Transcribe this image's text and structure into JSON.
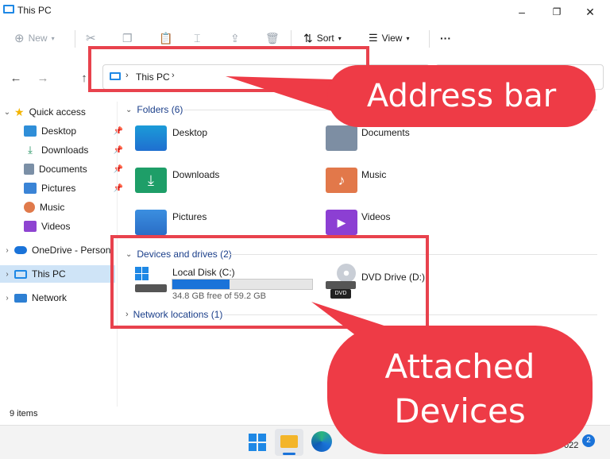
{
  "window": {
    "title": "This PC"
  },
  "toolbar": {
    "new_label": "New",
    "sort_label": "Sort",
    "view_label": "View",
    "more_label": "···"
  },
  "address": {
    "crumb": "This PC"
  },
  "sidebar": {
    "items": [
      {
        "label": "Quick access"
      },
      {
        "label": "Desktop"
      },
      {
        "label": "Downloads"
      },
      {
        "label": "Documents"
      },
      {
        "label": "Pictures"
      },
      {
        "label": "Music"
      },
      {
        "label": "Videos"
      },
      {
        "label": "OneDrive - Personal"
      },
      {
        "label": "This PC"
      },
      {
        "label": "Network"
      }
    ]
  },
  "folders": {
    "header": "Folders (6)",
    "items": [
      {
        "label": "Desktop"
      },
      {
        "label": "Documents"
      },
      {
        "label": "Downloads"
      },
      {
        "label": "Music"
      },
      {
        "label": "Pictures"
      },
      {
        "label": "Videos"
      }
    ]
  },
  "drives": {
    "header": "Devices and drives (2)",
    "local": {
      "label": "Local Disk (C:)",
      "free": "34.8 GB free of 59.2 GB",
      "used_fraction": 0.41
    },
    "dvd": {
      "label": "DVD Drive (D:)",
      "badge": "DVD"
    }
  },
  "network": {
    "header": "Network locations (1)"
  },
  "status": {
    "count": "9 items"
  },
  "taskbar": {
    "date_partial": "022",
    "notification_count": "2"
  },
  "annotations": {
    "address_label": "Address bar",
    "devices_label_line1": "Attached",
    "devices_label_line2": "Devices"
  },
  "colors": {
    "annotation_red": "#ee3b46",
    "accent_blue": "#1a73d9"
  }
}
